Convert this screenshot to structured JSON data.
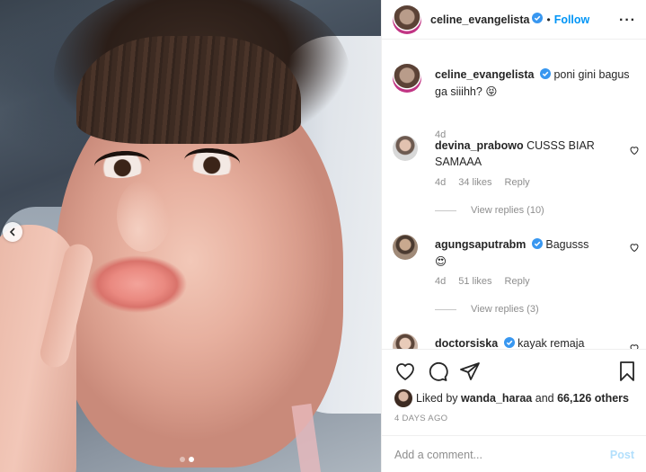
{
  "photo": {
    "slide_index": 2,
    "slide_count": 2,
    "prev_icon": "chevron-left-icon"
  },
  "header": {
    "username": "celine_evangelista",
    "separator": "•",
    "follow_label": "Follow",
    "more_label": "···"
  },
  "caption": {
    "username": "celine_evangelista",
    "text": "poni gini bagus ga siiihh?",
    "emoji": "😝",
    "time": "4d"
  },
  "comments": [
    {
      "username": "devina_prabowo",
      "text": "CUSSS BIAR SAMAAA",
      "time": "4d",
      "likes": "34 likes",
      "reply": "Reply",
      "view_replies": "View replies (10)"
    },
    {
      "username": "agungsaputrabm",
      "verified": true,
      "text": "Bagusss",
      "emoji": "😍",
      "time": "4d",
      "likes": "51 likes",
      "reply": "Reply",
      "view_replies": "View replies (3)"
    },
    {
      "username": "doctorsiska",
      "verified": true,
      "text": "kayak remaja"
    }
  ],
  "actions": {
    "liked_by_prefix": "Liked by",
    "liked_by_user": "wanda_haraa",
    "liked_by_mid": "and",
    "liked_by_count": "66,126 others",
    "posted": "4 DAYS AGO"
  },
  "add_comment": {
    "placeholder": "Add a comment...",
    "post_label": "Post"
  },
  "colors": {
    "accent": "#0095f6",
    "verified": "#3897f0",
    "muted": "#8e8e8e",
    "post_disabled": "#b2dffc"
  }
}
